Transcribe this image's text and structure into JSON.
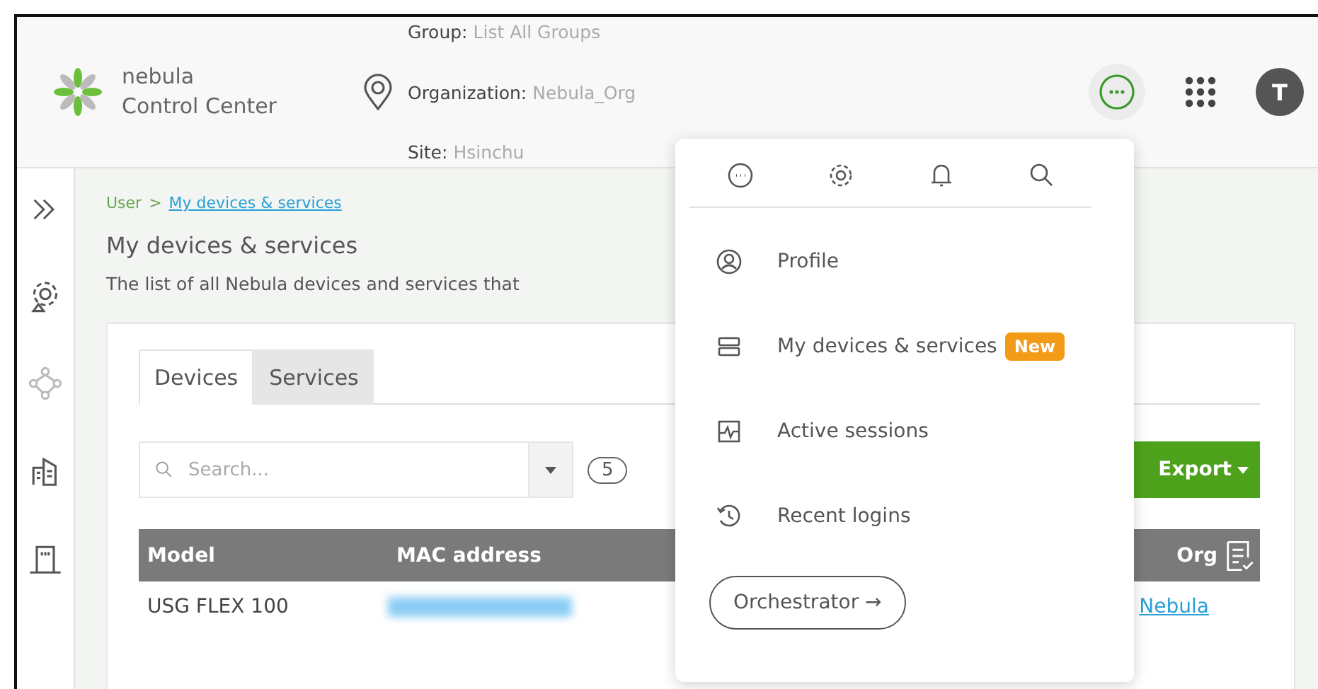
{
  "header": {
    "brand_line1": "nebula",
    "brand_line2": "Control Center",
    "scope": [
      {
        "label": "Group:",
        "value": "List All Groups"
      },
      {
        "label": "Organization:",
        "value": "Nebula_Org"
      },
      {
        "label": "Site:",
        "value": "Hsinchu"
      }
    ],
    "more_expanded": true,
    "avatar": "T"
  },
  "breadcrumb": {
    "parent": "User",
    "separator": ">",
    "current": "My devices & services"
  },
  "page": {
    "title": "My devices & services",
    "description": "The list of all Nebula devices and services that"
  },
  "tabs": [
    {
      "label": "Devices",
      "selected": true
    },
    {
      "label": "Services",
      "selected": false
    }
  ],
  "toolbar": {
    "search_placeholder": "Search...",
    "count": "5",
    "export": "Export"
  },
  "table": {
    "columns": [
      "Model",
      "MAC address",
      "Org"
    ],
    "rows": [
      {
        "model": "USG FLEX 100",
        "org": "Nebula"
      }
    ]
  },
  "menu": {
    "items": [
      {
        "label": "Profile"
      },
      {
        "label": "My devices & services",
        "badge": "New"
      },
      {
        "label": "Active sessions"
      },
      {
        "label": "Recent logins"
      }
    ],
    "button": "Orchestrator →"
  }
}
